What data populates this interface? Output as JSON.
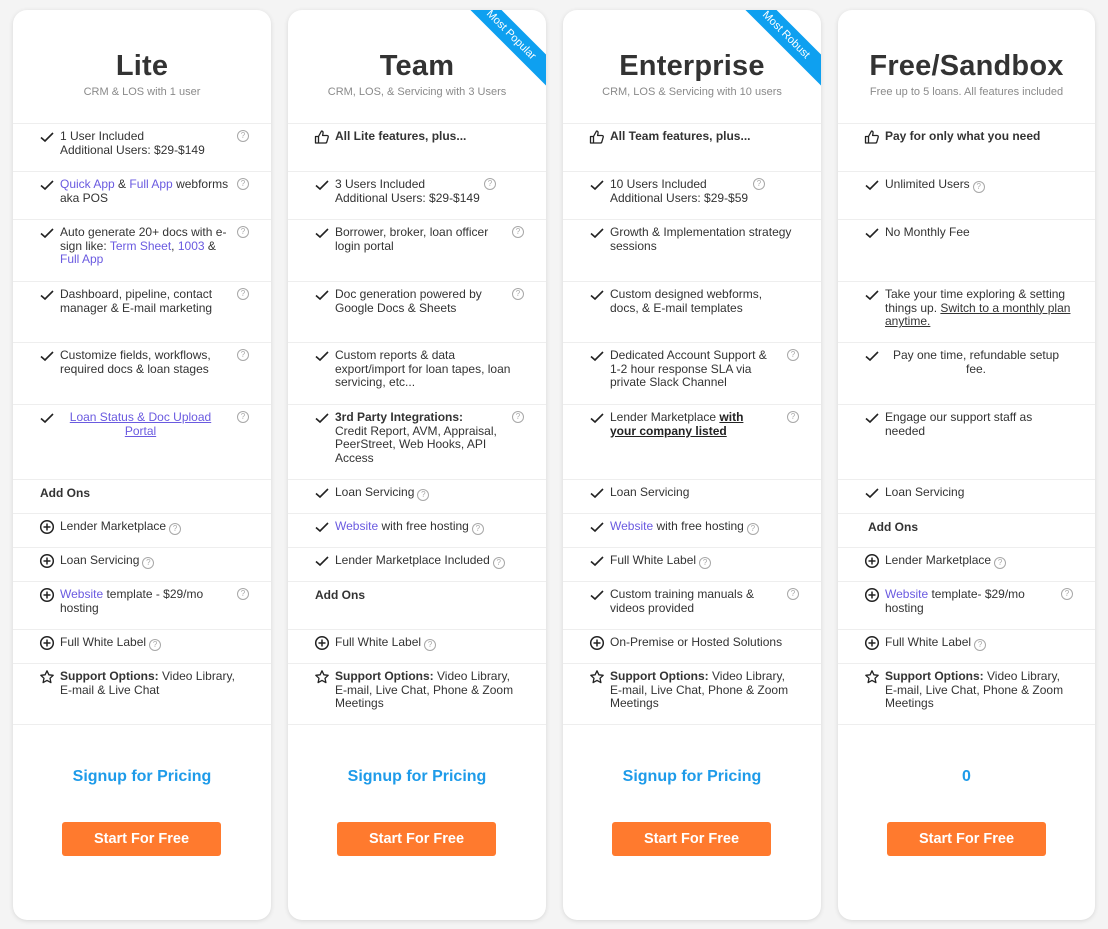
{
  "colors": {
    "accent_blue": "#1e9be9",
    "ribbon_blue": "#0ea0f0",
    "cta_orange": "#ff7a2e",
    "link_purple": "#6a5ae0"
  },
  "plans": [
    {
      "name": "Lite",
      "subtitle": "CRM & LOS with 1 user",
      "ribbon": null,
      "rows": [
        {
          "icon": "check-icon",
          "parts": [
            "1 User Included",
            "Additional Users: $29-$149"
          ],
          "help": true
        },
        {
          "icon": "check-icon",
          "link1": "Quick App",
          "t1": " & ",
          "link2": "Full App",
          "t2": " webforms aka POS",
          "help": true
        },
        {
          "icon": "check-icon",
          "t1": "Auto generate 20+ docs with e-sign like: ",
          "link1": "Term Sheet",
          "t2": ", ",
          "link2": "1003",
          "t3": " & ",
          "link3": "Full App",
          "help": true
        },
        {
          "icon": "check-icon",
          "text": "Dashboard, pipeline, contact manager & E-mail marketing",
          "help": true
        },
        {
          "icon": "check-icon",
          "text": "Customize fields, workflows, required docs & loan stages",
          "help": true
        },
        {
          "icon": "check-icon",
          "link": "Loan Status & Doc Upload Portal",
          "help": true
        },
        {
          "header": "Add Ons"
        },
        {
          "icon": "plus-circle-icon",
          "text": "Lender Marketplace",
          "help": true
        },
        {
          "icon": "plus-circle-icon",
          "text": "Loan Servicing",
          "help": true
        },
        {
          "icon": "plus-circle-icon",
          "link": "Website",
          "text": " template - $29/mo hosting",
          "help": true
        },
        {
          "icon": "plus-circle-icon",
          "text": "Full White Label",
          "help": true
        },
        {
          "icon": "star-icon",
          "bold": "Support Options:",
          "text": " Video Library, E-mail & Live Chat"
        }
      ],
      "price": "Signup for Pricing",
      "cta": "Start For Free"
    },
    {
      "name": "Team",
      "subtitle": "CRM, LOS, & Servicing with 3 Users",
      "ribbon": "Most Popular",
      "rows": [
        {
          "icon": "thumbs-up-icon",
          "bold": "All Lite features, plus..."
        },
        {
          "icon": "check-icon",
          "parts": [
            "3 Users Included",
            "Additional Users: $29-$149"
          ],
          "help": true
        },
        {
          "icon": "check-icon",
          "text": "Borrower, broker, loan officer login portal",
          "help": true
        },
        {
          "icon": "check-icon",
          "text": "Doc generation powered by Google Docs & Sheets",
          "help": true
        },
        {
          "icon": "check-icon",
          "text": "Custom reports & data export/import for loan tapes, loan servicing, etc..."
        },
        {
          "icon": "check-icon",
          "bold": "3rd Party Integrations:",
          "text": "Credit Report, AVM, Appraisal, PeerStreet, Web Hooks, API Access",
          "help": true
        },
        {
          "icon": "check-icon",
          "text": "Loan Servicing",
          "help": true
        },
        {
          "icon": "check-icon",
          "link": "Website",
          "text": " with free hosting",
          "help": true
        },
        {
          "icon": "check-icon",
          "text": "Lender Marketplace Included",
          "help": true
        },
        {
          "header": "Add Ons"
        },
        {
          "icon": "plus-circle-icon",
          "text": "Full White Label",
          "help": true
        },
        {
          "icon": "star-icon",
          "bold": "Support Options:",
          "text": " Video Library, E-mail, Live Chat, Phone & Zoom Meetings"
        }
      ],
      "price": "Signup for Pricing",
      "cta": "Start For Free"
    },
    {
      "name": "Enterprise",
      "subtitle": "CRM, LOS & Servicing with 10 users",
      "ribbon": "Most Robust",
      "rows": [
        {
          "icon": "thumbs-up-icon",
          "bold": "All Team features, plus..."
        },
        {
          "icon": "check-icon",
          "parts": [
            "10 Users Included",
            "Additional Users: $29-$59"
          ],
          "help": true
        },
        {
          "icon": "check-icon",
          "text": "Growth & Implementation strategy sessions"
        },
        {
          "icon": "check-icon",
          "text": "Custom designed webforms, docs, & E-mail templates"
        },
        {
          "icon": "check-icon",
          "text": "Dedicated Account Support & 1-2 hour response SLA via private Slack Channel",
          "help": true
        },
        {
          "icon": "check-icon",
          "text": "Lender Marketplace ",
          "bold_link": "with your company listed",
          "help": true
        },
        {
          "icon": "check-icon",
          "text": "Loan Servicing"
        },
        {
          "icon": "check-icon",
          "link": "Website",
          "text": " with free hosting",
          "help": true
        },
        {
          "icon": "check-icon",
          "text": "Full White Label",
          "help": true
        },
        {
          "icon": "check-icon",
          "text": "Custom training manuals & videos provided",
          "help": true
        },
        {
          "icon": "plus-circle-icon",
          "text": "On-Premise or Hosted Solutions"
        },
        {
          "icon": "star-icon",
          "bold": "Support Options:",
          "text": " Video Library, E-mail, Live Chat, Phone & Zoom Meetings"
        }
      ],
      "price": "Signup for Pricing",
      "cta": "Start For Free"
    },
    {
      "name": "Free/Sandbox",
      "subtitle": "Free up to 5 loans. All features included",
      "ribbon": null,
      "rows": [
        {
          "icon": "thumbs-up-icon",
          "bold": "Pay for only what you need"
        },
        {
          "icon": "check-icon",
          "text": "Unlimited Users",
          "help": true
        },
        {
          "icon": "check-icon",
          "text": "No Monthly Fee"
        },
        {
          "icon": "check-icon",
          "text": "Take your time exploring & setting things up. ",
          "uline": "Switch to a monthly plan anytime."
        },
        {
          "icon": "check-icon",
          "text": "Pay one time, refundable setup fee.",
          "center": true
        },
        {
          "icon": "check-icon",
          "text": "Engage our support staff as needed"
        },
        {
          "icon": "check-icon",
          "text": "Loan Servicing"
        },
        {
          "header": "Add Ons"
        },
        {
          "icon": "plus-circle-icon",
          "text": "Lender Marketplace",
          "help": true
        },
        {
          "icon": "plus-circle-icon",
          "link": "Website",
          "text": " template- $29/mo hosting",
          "help": true
        },
        {
          "icon": "plus-circle-icon",
          "text": "Full White Label",
          "help": true
        },
        {
          "icon": "star-icon",
          "bold": "Support Options:",
          "text": " Video Library, E-mail, Live Chat, Phone & Zoom Meetings"
        }
      ],
      "price": "0",
      "cta": "Start For Free"
    }
  ],
  "help_glyph": "?"
}
